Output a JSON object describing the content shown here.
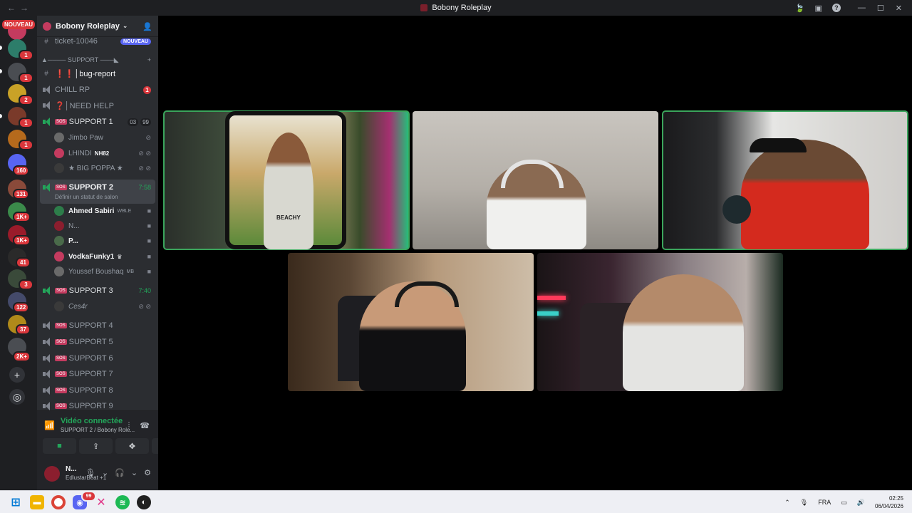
{
  "window": {
    "title": "Bobony Roleplay",
    "nav_back": "←",
    "nav_forward": "→"
  },
  "rail": {
    "nouveau_label": "NOUVEAU",
    "badges": [
      "1",
      "1",
      "2",
      "1",
      "1",
      "1",
      "2",
      "160",
      "131",
      "1K+",
      "1K+",
      "41",
      "3",
      "122",
      "37",
      "2K+"
    ]
  },
  "guild": {
    "name": "Bobony Roleplay"
  },
  "channels": {
    "ticket": {
      "name": "ticket-10046",
      "badge": "NOUVEAU"
    },
    "category": "▲──── SUPPORT ───◣",
    "bug_report": "❗❗│bug-report",
    "chill_rp": {
      "name": "CHILL RP",
      "unread": "1"
    },
    "need_help": "❓│NEED HELP",
    "support1": {
      "name": "SUPPORT 1",
      "count_a": "03",
      "count_b": "99",
      "users": [
        {
          "name": "Jimbo Paw"
        },
        {
          "name": "LHINDI",
          "tag": "NH82"
        },
        {
          "name": "★ BIG POPPA ★"
        }
      ]
    },
    "support2": {
      "name": "SUPPORT 2",
      "time": "7:58",
      "status_hint": "Définir un statut de salon",
      "users": [
        {
          "name": "Ahmed Sabiri",
          "tag": "WBLE"
        },
        {
          "name": "N..."
        },
        {
          "name": "P..."
        },
        {
          "name": "VodkaFunky1"
        },
        {
          "name": "Youssef Boushaq",
          "tag": "MB"
        }
      ]
    },
    "support3": {
      "name": "SUPPORT 3",
      "time": "7:40",
      "users": [
        {
          "name": "Ces4r"
        }
      ]
    },
    "support4": "SUPPORT 4",
    "support5": "SUPPORT 5",
    "support6": "SUPPORT 6",
    "support7": "SUPPORT 7",
    "support8": "SUPPORT 8",
    "support9": "SUPPORT 9"
  },
  "voice": {
    "status": "Vidéo connectée",
    "location": "SUPPORT 2 / Bobony Role..."
  },
  "me": {
    "name": "N...",
    "activity": "EdlustarBeat +1"
  },
  "video": {
    "shirt_text": "BEACHY"
  },
  "taskbar": {
    "lang": "FRA",
    "time": "02:25",
    "date": "06/04/2026",
    "discord_badge": "99"
  }
}
